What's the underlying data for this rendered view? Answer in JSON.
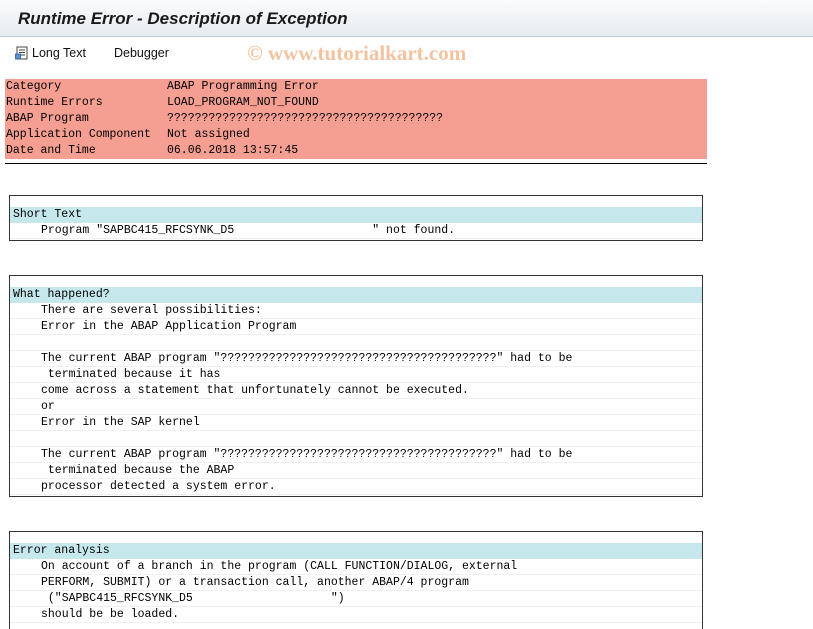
{
  "window": {
    "title": "Runtime Error - Description of Exception"
  },
  "toolbar": {
    "long_text_label": "Long Text",
    "debugger_label": "Debugger",
    "long_text_icon": "document-icon"
  },
  "watermark": "© www.tutorialkart.com",
  "header_rows": [
    {
      "label": "Category",
      "value": "ABAP Programming Error"
    },
    {
      "label": "Runtime Errors",
      "value": "LOAD_PROGRAM_NOT_FOUND"
    },
    {
      "label": "ABAP Program",
      "value": "????????????????????????????????????????"
    },
    {
      "label": "Application Component",
      "value": "Not assigned"
    },
    {
      "label": "Date and Time",
      "value": "06.06.2018 13:57:45"
    }
  ],
  "colors": {
    "header_bg": "#f59e92",
    "section_head_bg": "#c6e8ec"
  },
  "sections": {
    "short_text": {
      "heading": "Short Text",
      "lines": [
        "Program \"SAPBC415_RFCSYNK_D5                    \" not found."
      ]
    },
    "what_happened": {
      "heading": "What happened?",
      "lines": [
        "There are several possibilities:",
        "Error in the ABAP Application Program",
        "",
        "The current ABAP program \"????????????????????????????????????????\" had to be",
        " terminated because it has",
        "come across a statement that unfortunately cannot be executed.",
        "or",
        "Error in the SAP kernel",
        "",
        "The current ABAP program \"????????????????????????????????????????\" had to be",
        " terminated because the ABAP",
        "processor detected a system error."
      ]
    },
    "error_analysis": {
      "heading": "Error analysis",
      "lines": [
        "On account of a branch in the program (CALL FUNCTION/DIALOG, external",
        "PERFORM, SUBMIT) or a transaction call, another ABAP/4 program",
        " (\"SAPBC415_RFCSYNK_D5                    \")",
        "should be be loaded."
      ]
    }
  }
}
